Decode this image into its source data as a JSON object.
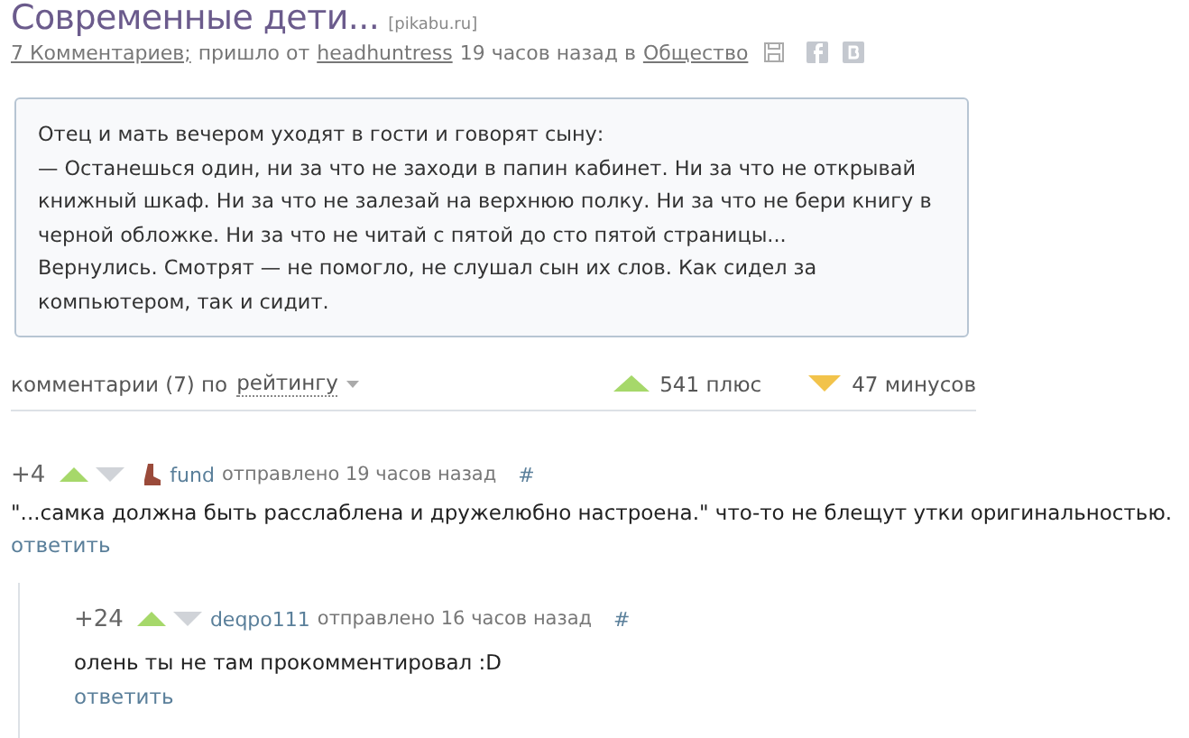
{
  "post": {
    "title": "Современные дети...",
    "source": "[pikabu.ru]",
    "comments_link": "7 Комментариев;",
    "meta_from": "пришло от",
    "author": "headhuntress",
    "meta_time": "19 часов назад в",
    "category": "Общество"
  },
  "story": [
    "Отец и мать вечером уходят в гости и говорят сыну:",
    "— Останешься один, ни за что не заходи в папин кабинет. Ни за что не открывай книжный шкаф. Ни за что не залезай на верхнюю полку. Ни за что не бери книгу в черной обложке. Ни за что не читай с пятой до сто пятой страницы...",
    "Вернулись. Смотрят — не помогло, не слушал сын их слов. Как сидел за компьютером, так и сидит."
  ],
  "comments_bar": {
    "label": "комментарии (7) по",
    "sort": "рейтингу",
    "plus": "541 плюс",
    "minus": "47 минусов"
  },
  "comments": [
    {
      "rating": "+4",
      "author": "fund",
      "posted": "отправлено 19 часов назад",
      "anchor": "#",
      "text": "\"...самка должна быть расслаблена и дружелюбно настроена.\" что-то не блещут утки оригинальностью.",
      "reply": "ответить",
      "children": [
        {
          "rating": "+24",
          "author": "deqpo111",
          "posted": "отправлено 16 часов назад",
          "anchor": "#",
          "text": "олень ты не там прокомментировал :D",
          "reply": "ответить"
        }
      ]
    }
  ]
}
